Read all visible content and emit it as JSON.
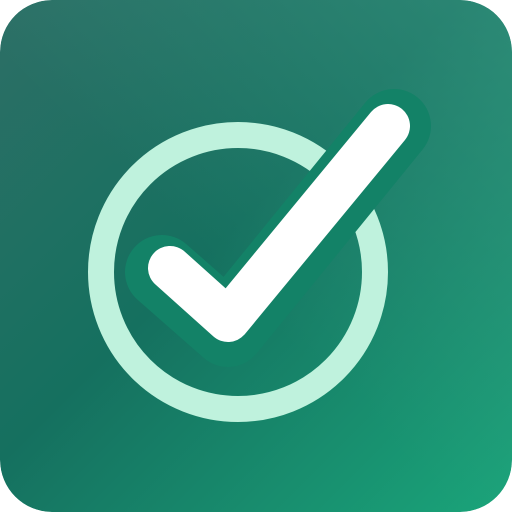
{
  "icon": {
    "name": "checkmark-app-icon",
    "glyph": "check-circle",
    "colors": {
      "background_start": "#2d6f66",
      "background_mid": "#15705f",
      "background_end": "#1aa57a",
      "background_highlight": "#3f9a86",
      "ring": "#bff2dd",
      "check": "#ffffff",
      "check_shadow": "#138267"
    }
  }
}
